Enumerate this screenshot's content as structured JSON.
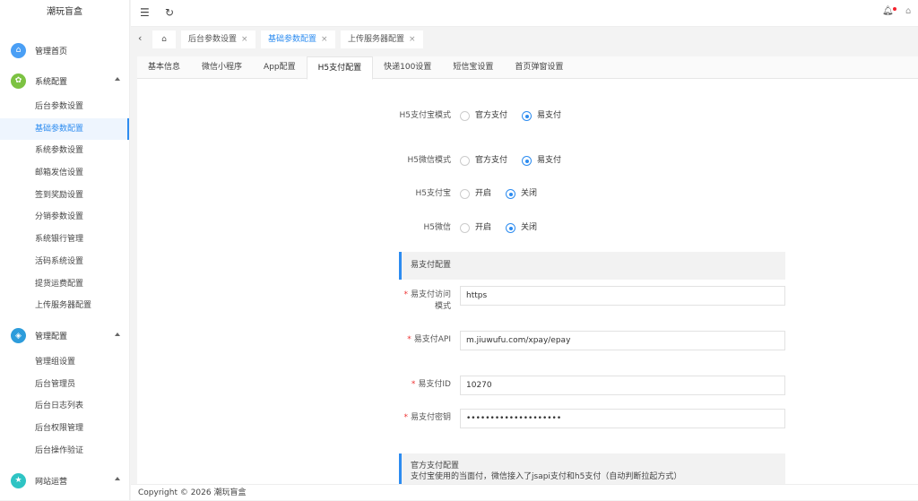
{
  "app_title": "潮玩盲盒",
  "sidebar": {
    "groups": [
      {
        "label": "管理首页",
        "icon": "home-icon",
        "color": "#4a9ff5",
        "items": []
      },
      {
        "label": "系统配置",
        "icon": "gear-icon",
        "color": "#7cc242",
        "items": [
          "后台参数设置",
          "基础参数配置",
          "系统参数设置",
          "邮箱发信设置",
          "签到奖励设置",
          "分销参数设置",
          "系统银行管理",
          "活码系统设置",
          "提货运费配置",
          "上传服务器配置"
        ]
      },
      {
        "label": "管理配置",
        "icon": "shield-icon",
        "color": "#2d9cdb",
        "items": [
          "管理组设置",
          "后台管理员",
          "后台日志列表",
          "后台权限管理",
          "后台操作验证"
        ]
      },
      {
        "label": "网站运营",
        "icon": "star-icon",
        "color": "#2ec4c4",
        "items": []
      }
    ],
    "active_item": "基础参数配置"
  },
  "tabs": [
    {
      "label": "后台参数设置"
    },
    {
      "label": "基础参数配置",
      "active": true
    },
    {
      "label": "上传服务器配置"
    }
  ],
  "subtabs": [
    "基本信息",
    "微信小程序",
    "App配置",
    "H5支付配置",
    "快递100设置",
    "短信宝设置",
    "首页弹窗设置"
  ],
  "active_subtab": "H5支付配置",
  "form": {
    "radios": [
      {
        "label": "H5支付宝模式",
        "options": [
          "官方支付",
          "易支付"
        ],
        "selected": "易支付"
      },
      {
        "label": "H5微信模式",
        "options": [
          "官方支付",
          "易支付"
        ],
        "selected": "易支付"
      },
      {
        "label": "H5支付宝",
        "options": [
          "开启",
          "关闭"
        ],
        "selected": "关闭"
      },
      {
        "label": "H5微信",
        "options": [
          "开启",
          "关闭"
        ],
        "selected": "关闭"
      }
    ],
    "section1": "易支付配置",
    "inputs": [
      {
        "label": "易支付访问模式",
        "value": "https"
      },
      {
        "label": "易支付API",
        "value": "m.jiuwufu.com/xpay/epay"
      },
      {
        "label": "易支付ID",
        "value": "10270"
      },
      {
        "label": "易支付密钥",
        "value": "••••••••••••••••••••"
      }
    ],
    "section2": "官方支付配置",
    "section2_desc": "支付宝使用的当面付，微信接入了jsapi支付和h5支付（自动判断拉起方式）"
  },
  "footer": "Copyright © 2026 潮玩盲盒",
  "accent": "#2d8cf0"
}
